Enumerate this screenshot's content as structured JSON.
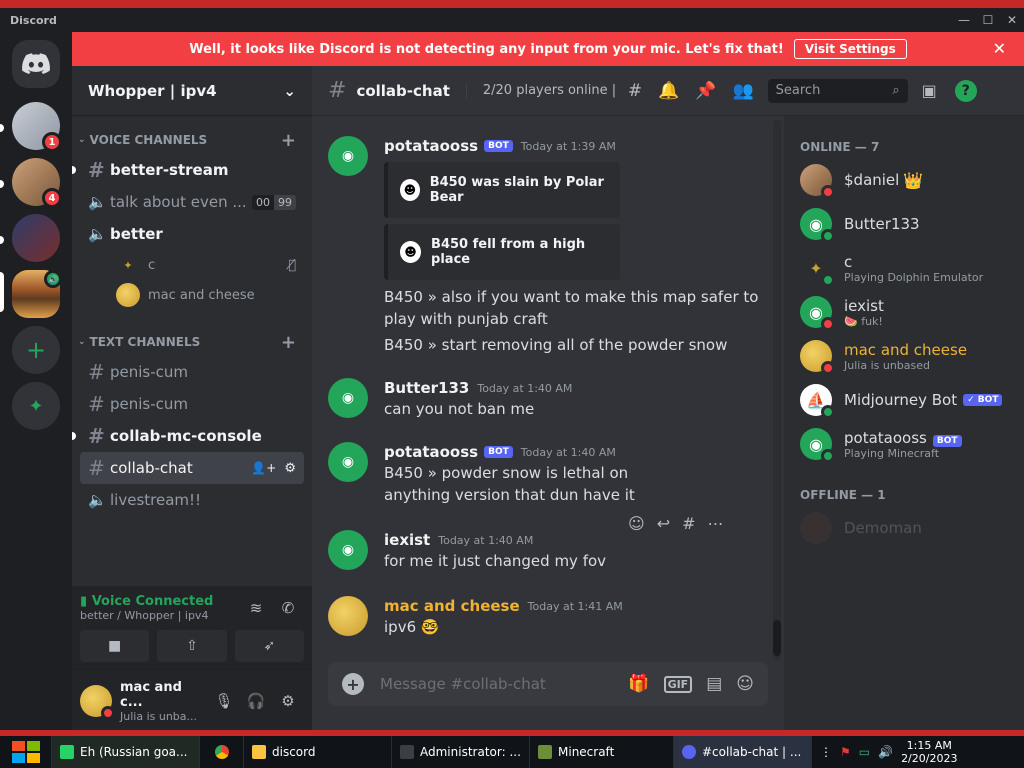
{
  "window": {
    "app_name": "Discord",
    "min": "—",
    "max": "☐",
    "close": "✕"
  },
  "banner": {
    "text": "Well, it looks like Discord is not detecting any input from your mic. Let's fix that!",
    "button": "Visit Settings",
    "close": "✕"
  },
  "guilds": {
    "badges": [
      "1",
      "4"
    ],
    "add": "+",
    "explore": "✦"
  },
  "server": {
    "name": "Whopper | ipv4",
    "chevron": "⌄"
  },
  "voice_category": "VOICE CHANNELS",
  "voice_channels": [
    {
      "name": "better-stream",
      "kind": "#"
    },
    {
      "name": "talk about even ...",
      "kind": "🔈",
      "count_a": "00",
      "count_b": "99"
    },
    {
      "name": "better",
      "kind": "🔈"
    }
  ],
  "voice_users": [
    {
      "name": "c"
    },
    {
      "name": "mac and cheese"
    }
  ],
  "text_category": "TEXT CHANNELS",
  "text_channels": [
    {
      "name": "penis-cum"
    },
    {
      "name": "penis-cum"
    },
    {
      "name": "collab-mc-console"
    },
    {
      "name": "collab-chat"
    },
    {
      "name": "livestream!!"
    }
  ],
  "voice_connected": {
    "status": "Voice Connected",
    "where": "better / Whopper | ipv4"
  },
  "user_panel": {
    "name": "mac and c...",
    "status": "Julia is unba..."
  },
  "channel": {
    "name": "collab-chat",
    "topic": "2/20 players online | ...",
    "search": "Search"
  },
  "messages": [
    {
      "author": "potataooss",
      "bot": "BOT",
      "time": "Today at 1:39 AM",
      "embeds": [
        "B450 was slain by Polar Bear",
        "B450 fell from a high place"
      ],
      "lines": [
        "B450 » also if you want to make this map safer to play with punjab craft",
        "B450 » start removing all of the powder snow"
      ]
    },
    {
      "author": "Butter133",
      "time": "Today at 1:40 AM",
      "lines": [
        "can you not ban me"
      ]
    },
    {
      "author": "potataooss",
      "bot": "BOT",
      "time": "Today at 1:40 AM",
      "lines": [
        "B450 » powder snow is lethal on anything version that dun have it"
      ]
    },
    {
      "author": "iexist",
      "time": "Today at 1:40 AM",
      "lines": [
        "for me it just changed my fov"
      ]
    },
    {
      "author": "mac and cheese",
      "time": "Today at 1:41 AM",
      "lines": [
        "ipv6 🤓"
      ]
    }
  ],
  "composer": {
    "placeholder": "Message #collab-chat",
    "gif": "GIF"
  },
  "members": {
    "online_header": "ONLINE — 7",
    "online": [
      {
        "name": "$daniel",
        "extra": "👑",
        "status": "",
        "dot": "#f23f43"
      },
      {
        "name": "Butter133",
        "status": "",
        "dot": "#23a55a"
      },
      {
        "name": "c",
        "status": "Playing Dolphin Emulator",
        "dot": "#23a55a"
      },
      {
        "name": "iexist",
        "status": "🍉 fuk!",
        "dot": "#f23f43"
      },
      {
        "name": "mac and cheese",
        "status": "Julia is unbased",
        "dot": "#f23f43"
      },
      {
        "name": "Midjourney Bot",
        "bot": "✓ BOT",
        "status": "",
        "dot": "#23a55a"
      },
      {
        "name": "potataooss",
        "bot": "BOT",
        "status": "Playing Minecraft",
        "dot": "#23a55a"
      }
    ],
    "offline_header": "OFFLINE — 1",
    "offline": [
      {
        "name": "Demoman"
      }
    ]
  },
  "taskbar": {
    "items": [
      "Eh (Russian goa...",
      "",
      "discord",
      "Administrator: ...",
      "Minecraft",
      "#collab-chat | ..."
    ],
    "time": "1:15 AM",
    "date": "2/20/2023"
  },
  "colors": {
    "accent": "#5865f2",
    "online": "#23a55a",
    "dnd": "#f23f43",
    "banner": "#f23f43"
  }
}
